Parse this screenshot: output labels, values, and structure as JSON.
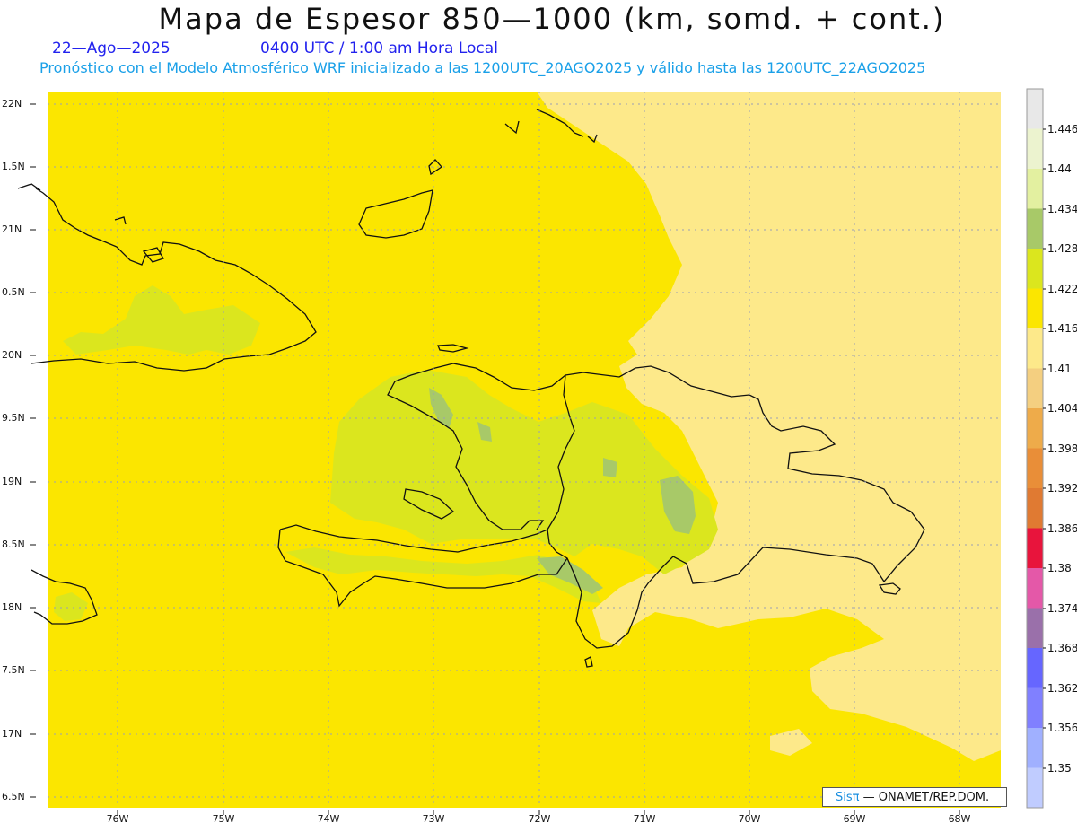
{
  "title": "Mapa de Espesor 850—1000 (km, somd. + cont.)",
  "date": "22—Ago—2025",
  "time": "0400 UTC / 1:00 am Hora Local",
  "subtitle": "Pronóstico con el Modelo Atmosférico WRF inicializado a las 1200UTC_20AGO2025 y válido hasta las  1200UTC_22AGO2025",
  "latitude_labels": [
    "22N",
    "1.5N",
    "21N",
    "0.5N",
    "20N",
    "9.5N",
    "19N",
    "8.5N",
    "18N",
    "7.5N",
    "17N",
    "6.5N"
  ],
  "longitude_labels": [
    "76W",
    "75W",
    "74W",
    "73W",
    "72W",
    "71W",
    "70W",
    "69W",
    "68W"
  ],
  "colorbar": {
    "labels": [
      "1.446",
      "1.44",
      "1.434",
      "1.428",
      "1.422",
      "1.416",
      "1.41",
      "1.404",
      "1.398",
      "1.392",
      "1.386",
      "1.38",
      "1.374",
      "1.368",
      "1.362",
      "1.356",
      "1.35"
    ],
    "colors": [
      "#e8e8e8",
      "#ecf3cf",
      "#e3f0a0",
      "#a8c968",
      "#dbe61e",
      "#fbe600",
      "#fde98a",
      "#f4cf80",
      "#eeab4a",
      "#e98e38",
      "#e07a32",
      "#e8143c",
      "#e458a8",
      "#9a70aa",
      "#6666ff",
      "#8080ff",
      "#a0b0ff",
      "#c0ccff"
    ]
  },
  "credit": {
    "logo": "Sisπ",
    "text": "— ONAMET/REP.DOM."
  },
  "fill_colors": {
    "base": "#fbe600",
    "east": "#fde98a",
    "green": "#dbe61e",
    "dark_green": "#a8c968",
    "coast": "#111111",
    "grid": "#9aa0b4"
  }
}
